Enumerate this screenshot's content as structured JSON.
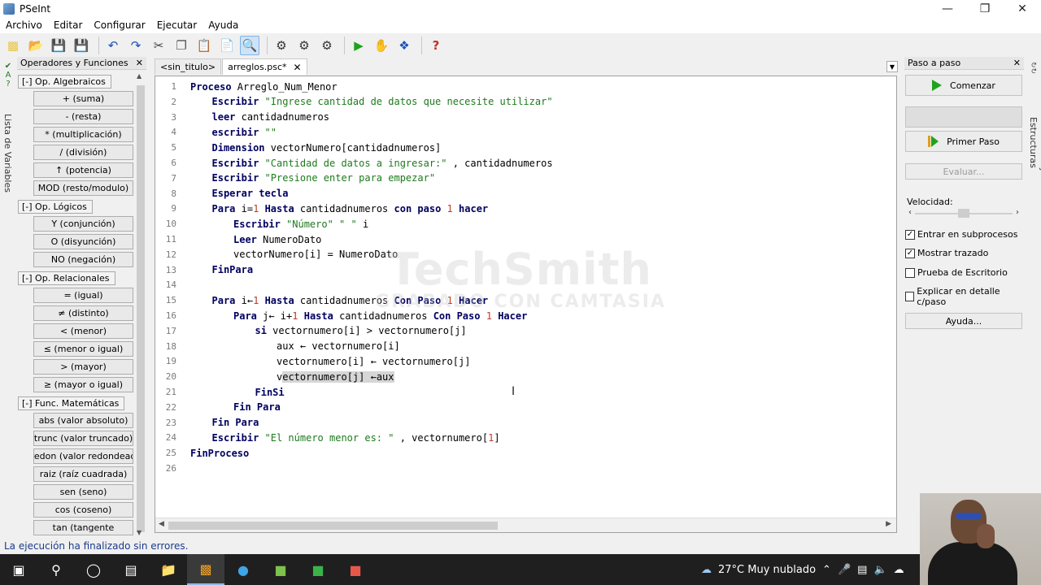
{
  "window": {
    "title": "PSeInt"
  },
  "menu": [
    "Archivo",
    "Editar",
    "Configurar",
    "Ejecutar",
    "Ayuda"
  ],
  "toolbar": {
    "icons": [
      "new-file-icon",
      "open-file-icon",
      "save-icon",
      "save-as-icon",
      "undo-icon",
      "redo-icon",
      "cut-icon",
      "copy-icon",
      "paste-icon",
      "find-icon",
      "replace-icon",
      "indent-icon",
      "syntax-check-icon",
      "settings-icon",
      "run-icon",
      "step-run-icon",
      "flowchart-icon",
      "help-icon"
    ]
  },
  "left_strip": {
    "label": "Lista de Variables"
  },
  "operators_panel": {
    "title": "Operadores y Funciones",
    "groups": [
      {
        "label": "[-]  Op. Algebraicos",
        "items": [
          "+ (suma)",
          "- (resta)",
          "* (multiplicación)",
          "/ (división)",
          "↑ (potencia)",
          "MOD (resto/modulo)"
        ]
      },
      {
        "label": "[-]  Op. Lógicos",
        "items": [
          "Y (conjunción)",
          "O (disyunción)",
          "NO (negación)"
        ]
      },
      {
        "label": "[-]  Op. Relacionales",
        "items": [
          "= (igual)",
          "≠ (distinto)",
          "< (menor)",
          "≤ (menor o igual)",
          "> (mayor)",
          "≥ (mayor o igual)"
        ]
      },
      {
        "label": "[-]  Func. Matemáticas",
        "items": [
          "abs (valor absoluto)",
          "trunc (valor truncado)",
          "redon (valor redondead",
          "raiz (raíz cuadrada)",
          "sen (seno)",
          "cos (coseno)",
          "tan (tangente"
        ]
      }
    ]
  },
  "tabs": [
    {
      "label": "<sin_titulo>",
      "active": false
    },
    {
      "label": "arreglos.psc*",
      "active": true,
      "close": "✕"
    }
  ],
  "code": [
    {
      "n": "1",
      "indent": 0,
      "tokens": [
        [
          "kw",
          "Proceso"
        ],
        [
          "id",
          " Arreglo_Num_Menor"
        ]
      ]
    },
    {
      "n": "2",
      "indent": 1,
      "tokens": [
        [
          "kw",
          "Escribir"
        ],
        [
          "id",
          " "
        ],
        [
          "str",
          "\"Ingrese cantidad de datos que necesite utilizar\""
        ]
      ]
    },
    {
      "n": "3",
      "indent": 1,
      "tokens": [
        [
          "kw",
          "leer"
        ],
        [
          "id",
          " cantidadnumeros"
        ]
      ]
    },
    {
      "n": "4",
      "indent": 1,
      "tokens": [
        [
          "kw",
          "escribir"
        ],
        [
          "id",
          " "
        ],
        [
          "str",
          "\"\""
        ]
      ]
    },
    {
      "n": "5",
      "indent": 1,
      "tokens": [
        [
          "kw",
          "Dimension"
        ],
        [
          "id",
          " vectorNumero[cantidadnumeros]"
        ]
      ]
    },
    {
      "n": "6",
      "indent": 1,
      "tokens": [
        [
          "kw",
          "Escribir"
        ],
        [
          "id",
          " "
        ],
        [
          "str",
          "\"Cantidad de datos a ingresar:\""
        ],
        [
          "id",
          " , cantidadnumeros"
        ]
      ]
    },
    {
      "n": "7",
      "indent": 1,
      "tokens": [
        [
          "kw",
          "Escribir"
        ],
        [
          "id",
          " "
        ],
        [
          "str",
          "\"Presione enter para empezar\""
        ]
      ]
    },
    {
      "n": "8",
      "indent": 1,
      "tokens": [
        [
          "kw",
          "Esperar tecla"
        ]
      ]
    },
    {
      "n": "9",
      "indent": 1,
      "tokens": [
        [
          "kw",
          "Para"
        ],
        [
          "id",
          " i="
        ],
        [
          "num",
          "1"
        ],
        [
          "id",
          " "
        ],
        [
          "kw",
          "Hasta"
        ],
        [
          "id",
          " cantidadnumeros "
        ],
        [
          "kw",
          "con paso"
        ],
        [
          "id",
          " "
        ],
        [
          "num",
          "1"
        ],
        [
          "id",
          " "
        ],
        [
          "kw",
          "hacer"
        ]
      ]
    },
    {
      "n": "10",
      "indent": 2,
      "tokens": [
        [
          "kw",
          "Escribir"
        ],
        [
          "id",
          " "
        ],
        [
          "str",
          "\"Número\" \" \""
        ],
        [
          "id",
          " i"
        ]
      ]
    },
    {
      "n": "11",
      "indent": 2,
      "tokens": [
        [
          "kw",
          "Leer"
        ],
        [
          "id",
          " NumeroDato"
        ]
      ]
    },
    {
      "n": "12",
      "indent": 2,
      "tokens": [
        [
          "id",
          "vectorNumero[i] = NumeroDato"
        ]
      ]
    },
    {
      "n": "13",
      "indent": 1,
      "tokens": [
        [
          "kw",
          "FinPara"
        ]
      ]
    },
    {
      "n": "14",
      "indent": 0,
      "tokens": []
    },
    {
      "n": "15",
      "indent": 1,
      "tokens": [
        [
          "kw",
          "Para"
        ],
        [
          "id",
          " i←"
        ],
        [
          "num",
          "1"
        ],
        [
          "id",
          " "
        ],
        [
          "kw",
          "Hasta"
        ],
        [
          "id",
          " cantidadnumeros "
        ],
        [
          "kw",
          "Con Paso"
        ],
        [
          "id",
          " "
        ],
        [
          "num",
          "1"
        ],
        [
          "id",
          " "
        ],
        [
          "kw",
          "Hacer"
        ]
      ]
    },
    {
      "n": "16",
      "indent": 2,
      "tokens": [
        [
          "kw",
          "Para"
        ],
        [
          "id",
          " j← i+"
        ],
        [
          "num",
          "1"
        ],
        [
          "id",
          " "
        ],
        [
          "kw",
          "Hasta"
        ],
        [
          "id",
          " cantidadnumeros "
        ],
        [
          "kw",
          "Con Paso"
        ],
        [
          "id",
          " "
        ],
        [
          "num",
          "1"
        ],
        [
          "id",
          " "
        ],
        [
          "kw",
          "Hacer"
        ]
      ]
    },
    {
      "n": "17",
      "indent": 3,
      "tokens": [
        [
          "kw",
          "si"
        ],
        [
          "id",
          " vectornumero[i] > vectornumero[j]"
        ]
      ]
    },
    {
      "n": "18",
      "indent": 4,
      "tokens": [
        [
          "id",
          "aux ← vectornumero[i]"
        ]
      ]
    },
    {
      "n": "19",
      "indent": 4,
      "tokens": [
        [
          "id",
          "vectornumero[i] ← vectornumero[j]"
        ]
      ]
    },
    {
      "n": "20",
      "indent": 4,
      "tokens": [
        [
          "id",
          "v"
        ],
        [
          "hl",
          "ectornumero[j] ←aux"
        ]
      ]
    },
    {
      "n": "21",
      "indent": 3,
      "tokens": [
        [
          "kw",
          "FinSi"
        ]
      ]
    },
    {
      "n": "22",
      "indent": 2,
      "tokens": [
        [
          "kw",
          "Fin Para"
        ]
      ]
    },
    {
      "n": "23",
      "indent": 1,
      "tokens": [
        [
          "kw",
          "Fin Para"
        ]
      ]
    },
    {
      "n": "24",
      "indent": 1,
      "tokens": [
        [
          "kw",
          "Escribir"
        ],
        [
          "id",
          " "
        ],
        [
          "str",
          "\"El número menor es: \""
        ],
        [
          "id",
          " , vectornumero["
        ],
        [
          "num",
          "1"
        ],
        [
          "id",
          "]"
        ]
      ]
    },
    {
      "n": "25",
      "indent": 0,
      "tokens": [
        [
          "kw",
          "FinProceso"
        ]
      ]
    },
    {
      "n": "26",
      "indent": 0,
      "tokens": []
    }
  ],
  "watermark": {
    "line1": "TechSmith",
    "line2": "GRABADO CON CAMTASIA"
  },
  "step_panel": {
    "title": "Paso a paso",
    "start": "Comenzar",
    "first_step": "Primer Paso",
    "evaluate": "Evaluar...",
    "speed_label": "Velocidad:",
    "speed_value": 0.5,
    "options": [
      {
        "label": "Entrar en subprocesos",
        "checked": true
      },
      {
        "label": "Mostrar trazado",
        "checked": true
      },
      {
        "label": "Prueba de Escritorio",
        "checked": false
      },
      {
        "label": "Explicar en detalle c/paso",
        "checked": false
      }
    ],
    "help": "Ayuda..."
  },
  "right_strip": {
    "label": "Comandos y Estructuras"
  },
  "status": "La ejecución ha finalizado sin errores.",
  "taskbar": {
    "weather": "27°C  Muy nublado"
  },
  "colors": {
    "keyword": "#000060",
    "string": "#1e7a1e",
    "number": "#c0392b",
    "status": "#1b3a8a"
  }
}
